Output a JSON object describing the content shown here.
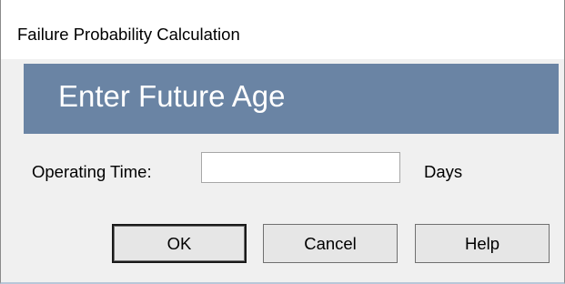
{
  "window": {
    "title": "Failure Probability Calculation"
  },
  "banner": {
    "heading": "Enter Future Age"
  },
  "form": {
    "operating_time_label": "Operating Time:",
    "operating_time_value": "",
    "unit_label": "Days"
  },
  "buttons": {
    "ok_label": "OK",
    "cancel_label": "Cancel",
    "help_label": "Help"
  },
  "colors": {
    "banner_background": "#6a84a4",
    "dialog_background": "#f0f0f0",
    "titlebar_background": "#ffffff"
  }
}
